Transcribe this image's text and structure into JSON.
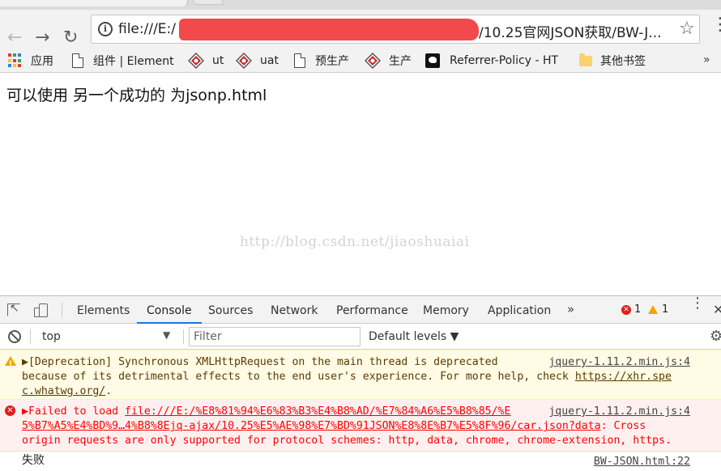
{
  "browser": {
    "url_prefix": "file:///E:/",
    "url_suffix": "/10.25官网JSON获取/BW-J...",
    "bookmarks": [
      {
        "label": "应用",
        "icon": "apps-grid-icon"
      },
      {
        "label": "组件 | Element",
        "icon": "page-icon"
      },
      {
        "label": "ut",
        "icon": "diamond-icon"
      },
      {
        "label": "uat",
        "icon": "diamond-icon"
      },
      {
        "label": "预生产",
        "icon": "page-icon"
      },
      {
        "label": "生产",
        "icon": "diamond-icon"
      },
      {
        "label": "Referrer-Policy - HT",
        "icon": "site-icon"
      },
      {
        "label": "其他书签",
        "icon": "folder-icon"
      }
    ],
    "overflow_label": "»"
  },
  "page": {
    "text": "可以使用 另一个成功的 为jsonp.html",
    "watermark": "http://blog.csdn.net/jiaoshuaiai"
  },
  "devtools": {
    "tabs": [
      "Elements",
      "Console",
      "Sources",
      "Network",
      "Performance",
      "Memory",
      "Application"
    ],
    "active_tab": "Console",
    "more_tabs": "»",
    "error_count": "1",
    "warning_count": "1",
    "context": "top",
    "filter_placeholder": "Filter",
    "levels_label": "Default levels ▼",
    "messages": {
      "warning": {
        "text_a": "▶[Deprecation] Synchronous XMLHttpRequest on the main thread is deprecated\nbecause of its detrimental effects to the end user's experience. For more help, check ",
        "link": "https://xhr.spe\nc.whatwg.org/",
        "text_b": ".",
        "source": "jquery-1.11.2.min.js:4"
      },
      "error": {
        "text_a": "▶Failed to load ",
        "link": "file:///E:/%E8%81%94%E6%83%B3%E4%B8%AD/%E7%84%A6%E5%B8%85/%E\n5%B7%A5%E4%BD%9…4%B8%8Ejq-ajax/10.25%E5%AE%98%E7%BD%91JSON%E8%8E%B7%E5%8F%96/car.json?data",
        "text_b": ": Cross\norigin requests are only supported for protocol schemes: http, data, chrome, chrome-extension, https.",
        "source": "jquery-1.11.2.min.js:4"
      },
      "log": {
        "text": "失败",
        "source": "BW-JSON.html:22"
      }
    }
  },
  "colors": {
    "redaction": "#f24a4a",
    "active_tab_underline": "#1a73e8",
    "error": "#ff0000",
    "warning_bg": "#fffbe5",
    "error_bg": "#fff0f0"
  }
}
